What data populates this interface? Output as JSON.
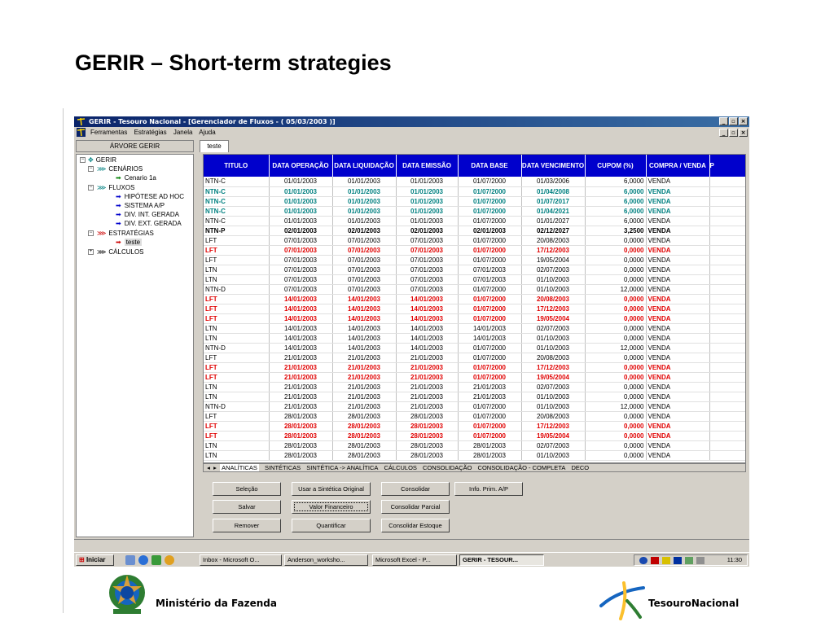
{
  "slide": {
    "title": "GERIR – Short-term strategies",
    "footer_left": "Ministério da Fazenda",
    "footer_right": "TesouroNacional"
  },
  "window": {
    "title": "GERIR - Tesouro Nacional - [Gerenciador de Fluxos - ( 05/03/2003 )]",
    "menu": [
      "Ferramentas",
      "Estratégias",
      "Janela",
      "Ajuda"
    ]
  },
  "tree": {
    "header": "ÁRVORE GERIR",
    "nodes": {
      "gerir": "GERIR",
      "cenarios": "CENÁRIOS",
      "cenario1a": "Cenario 1a",
      "fluxos": "FLUXOS",
      "hipotese": "HIPÓTESE AD HOC",
      "sistema": "SISTEMA A/P",
      "divint": "DIV. INT. GERADA",
      "divext": "DIV. EXT. GERADA",
      "estrategias": "ESTRATÉGIAS",
      "teste": "teste",
      "calculos": "CÁLCULOS"
    }
  },
  "doc_tab": "teste",
  "grid": {
    "headers": [
      "TITULO",
      "DATA OPERAÇÃO",
      "DATA LIQUIDAÇÃO",
      "DATA EMISSÃO",
      "DATA BASE",
      "DATA VENCIMENTO",
      "CUPOM (%)",
      "COMPRA / VENDA",
      "P"
    ],
    "rows": [
      {
        "style": "",
        "cells": [
          "NTN-C",
          "01/01/2003",
          "01/01/2003",
          "01/01/2003",
          "01/07/2000",
          "01/03/2006",
          "6,0000",
          "VENDA"
        ]
      },
      {
        "style": "teal",
        "cells": [
          "NTN-C",
          "01/01/2003",
          "01/01/2003",
          "01/01/2003",
          "01/07/2000",
          "01/04/2008",
          "6,0000",
          "VENDA"
        ]
      },
      {
        "style": "teal",
        "cells": [
          "NTN-C",
          "01/01/2003",
          "01/01/2003",
          "01/01/2003",
          "01/07/2000",
          "01/07/2017",
          "6,0000",
          "VENDA"
        ]
      },
      {
        "style": "teal",
        "cells": [
          "NTN-C",
          "01/01/2003",
          "01/01/2003",
          "01/01/2003",
          "01/07/2000",
          "01/04/2021",
          "6,0000",
          "VENDA"
        ]
      },
      {
        "style": "",
        "cells": [
          "NTN-C",
          "01/01/2003",
          "01/01/2003",
          "01/01/2003",
          "01/07/2000",
          "01/01/2027",
          "6,0000",
          "VENDA"
        ]
      },
      {
        "style": "bold",
        "cells": [
          "NTN-P",
          "02/01/2003",
          "02/01/2003",
          "02/01/2003",
          "02/01/2003",
          "02/12/2027",
          "3,2500",
          "VENDA"
        ]
      },
      {
        "style": "",
        "cells": [
          "LFT",
          "07/01/2003",
          "07/01/2003",
          "07/01/2003",
          "01/07/2000",
          "20/08/2003",
          "0,0000",
          "VENDA"
        ]
      },
      {
        "style": "red",
        "cells": [
          "LFT",
          "07/01/2003",
          "07/01/2003",
          "07/01/2003",
          "01/07/2000",
          "17/12/2003",
          "0,0000",
          "VENDA"
        ]
      },
      {
        "style": "",
        "cells": [
          "LFT",
          "07/01/2003",
          "07/01/2003",
          "07/01/2003",
          "01/07/2000",
          "19/05/2004",
          "0,0000",
          "VENDA"
        ]
      },
      {
        "style": "",
        "cells": [
          "LTN",
          "07/01/2003",
          "07/01/2003",
          "07/01/2003",
          "07/01/2003",
          "02/07/2003",
          "0,0000",
          "VENDA"
        ]
      },
      {
        "style": "",
        "cells": [
          "LTN",
          "07/01/2003",
          "07/01/2003",
          "07/01/2003",
          "07/01/2003",
          "01/10/2003",
          "0,0000",
          "VENDA"
        ]
      },
      {
        "style": "",
        "cells": [
          "NTN-D",
          "07/01/2003",
          "07/01/2003",
          "07/01/2003",
          "01/07/2000",
          "01/10/2003",
          "12,0000",
          "VENDA"
        ]
      },
      {
        "style": "red",
        "cells": [
          "LFT",
          "14/01/2003",
          "14/01/2003",
          "14/01/2003",
          "01/07/2000",
          "20/08/2003",
          "0,0000",
          "VENDA"
        ]
      },
      {
        "style": "red",
        "cells": [
          "LFT",
          "14/01/2003",
          "14/01/2003",
          "14/01/2003",
          "01/07/2000",
          "17/12/2003",
          "0,0000",
          "VENDA"
        ]
      },
      {
        "style": "red",
        "cells": [
          "LFT",
          "14/01/2003",
          "14/01/2003",
          "14/01/2003",
          "01/07/2000",
          "19/05/2004",
          "0,0000",
          "VENDA"
        ]
      },
      {
        "style": "",
        "cells": [
          "LTN",
          "14/01/2003",
          "14/01/2003",
          "14/01/2003",
          "14/01/2003",
          "02/07/2003",
          "0,0000",
          "VENDA"
        ]
      },
      {
        "style": "",
        "cells": [
          "LTN",
          "14/01/2003",
          "14/01/2003",
          "14/01/2003",
          "14/01/2003",
          "01/10/2003",
          "0,0000",
          "VENDA"
        ]
      },
      {
        "style": "",
        "cells": [
          "NTN-D",
          "14/01/2003",
          "14/01/2003",
          "14/01/2003",
          "01/07/2000",
          "01/10/2003",
          "12,0000",
          "VENDA"
        ]
      },
      {
        "style": "",
        "cells": [
          "LFT",
          "21/01/2003",
          "21/01/2003",
          "21/01/2003",
          "01/07/2000",
          "20/08/2003",
          "0,0000",
          "VENDA"
        ]
      },
      {
        "style": "red",
        "cells": [
          "LFT",
          "21/01/2003",
          "21/01/2003",
          "21/01/2003",
          "01/07/2000",
          "17/12/2003",
          "0,0000",
          "VENDA"
        ]
      },
      {
        "style": "red",
        "cells": [
          "LFT",
          "21/01/2003",
          "21/01/2003",
          "21/01/2003",
          "01/07/2000",
          "19/05/2004",
          "0,0000",
          "VENDA"
        ]
      },
      {
        "style": "",
        "cells": [
          "LTN",
          "21/01/2003",
          "21/01/2003",
          "21/01/2003",
          "21/01/2003",
          "02/07/2003",
          "0,0000",
          "VENDA"
        ]
      },
      {
        "style": "",
        "cells": [
          "LTN",
          "21/01/2003",
          "21/01/2003",
          "21/01/2003",
          "21/01/2003",
          "01/10/2003",
          "0,0000",
          "VENDA"
        ]
      },
      {
        "style": "",
        "cells": [
          "NTN-D",
          "21/01/2003",
          "21/01/2003",
          "21/01/2003",
          "01/07/2000",
          "01/10/2003",
          "12,0000",
          "VENDA"
        ]
      },
      {
        "style": "",
        "cells": [
          "LFT",
          "28/01/2003",
          "28/01/2003",
          "28/01/2003",
          "01/07/2000",
          "20/08/2003",
          "0,0000",
          "VENDA"
        ]
      },
      {
        "style": "red",
        "cells": [
          "LFT",
          "28/01/2003",
          "28/01/2003",
          "28/01/2003",
          "01/07/2000",
          "17/12/2003",
          "0,0000",
          "VENDA"
        ]
      },
      {
        "style": "red",
        "cells": [
          "LFT",
          "28/01/2003",
          "28/01/2003",
          "28/01/2003",
          "01/07/2000",
          "19/05/2004",
          "0,0000",
          "VENDA"
        ]
      },
      {
        "style": "",
        "cells": [
          "LTN",
          "28/01/2003",
          "28/01/2003",
          "28/01/2003",
          "28/01/2003",
          "02/07/2003",
          "0,0000",
          "VENDA"
        ]
      },
      {
        "style": "",
        "cells": [
          "LTN",
          "28/01/2003",
          "28/01/2003",
          "28/01/2003",
          "28/01/2003",
          "01/10/2003",
          "0,0000",
          "VENDA"
        ]
      }
    ]
  },
  "sheet_tabs": [
    "ANALÍTICAS",
    "SINTÉTICAS",
    "SINTÉTICA -> ANALÍTICA",
    "CÁLCULOS",
    "CONSOLIDAÇÃO",
    "CONSOLIDAÇÃO - COMPLETA",
    "DECO"
  ],
  "buttons": {
    "selecao": "Seleção",
    "usar": "Usar a Sintética Original",
    "consolidar": "Consolidar",
    "info": "Info. Prim. A/P",
    "salvar": "Salvar",
    "valor": "Valor Financeiro",
    "consolidar_parcial": "Consolidar Parcial",
    "remover": "Remover",
    "quantificar": "Quantificar",
    "consolidar_estoque": "Consolidar Estoque"
  },
  "taskbar": {
    "start": "Iniciar",
    "tasks": [
      "Inbox - Microsoft O...",
      "Anderson_worksho...",
      "Microsoft Excel - P...",
      "GERIR - TESOUR..."
    ],
    "clock": "11:30"
  },
  "colors": {
    "header_blue": "#0000cc",
    "row_red": "#e00000",
    "row_teal": "#008080",
    "title_gradient_start": "#0a246a"
  }
}
